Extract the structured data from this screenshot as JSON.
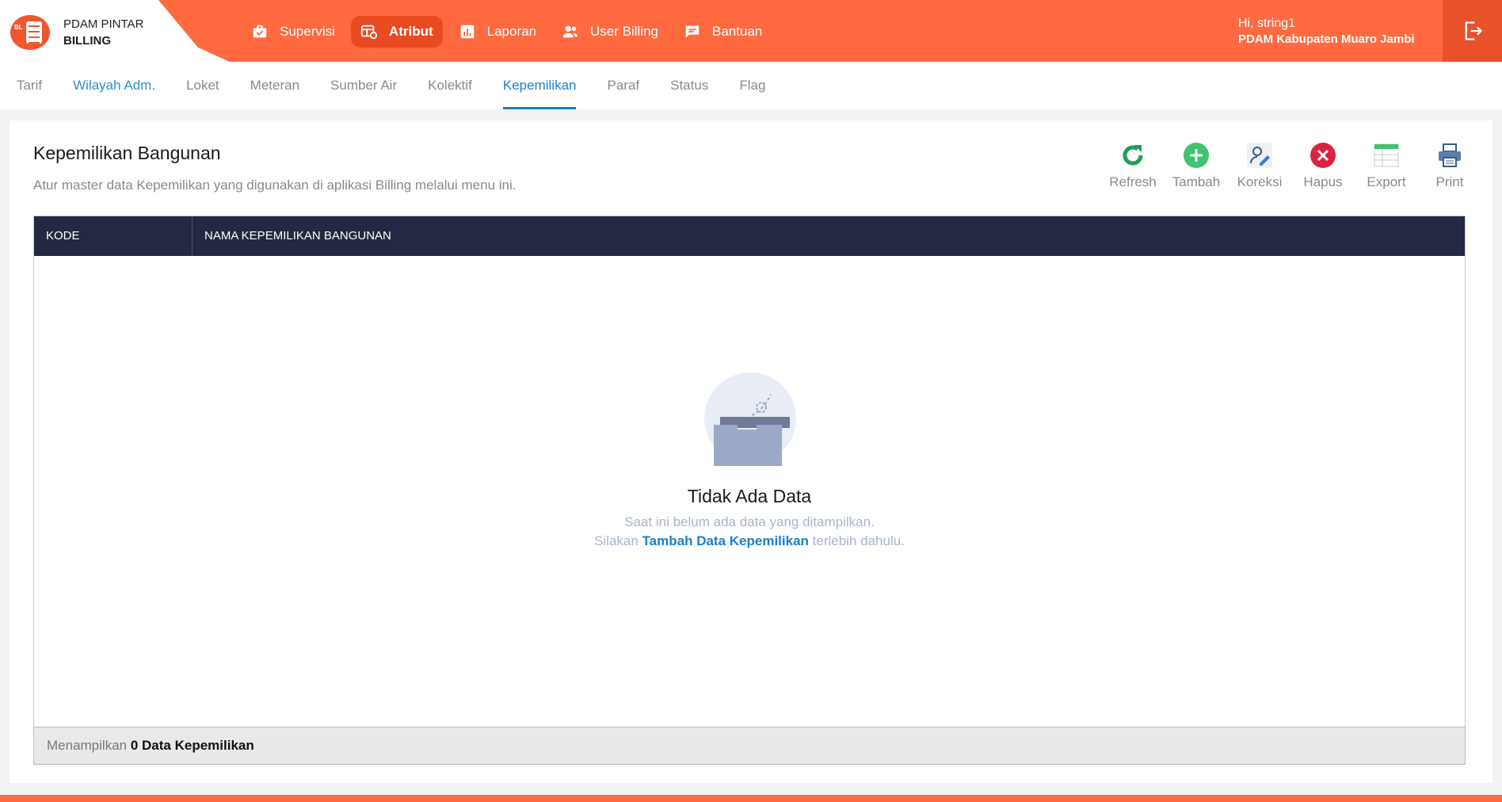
{
  "brand": {
    "line1": "PDAM PINTAR",
    "line2": "BILLING",
    "logo_text": "BL"
  },
  "mainnav": [
    {
      "label": "Supervisi",
      "icon": "briefcase-icon",
      "active": false
    },
    {
      "label": "Atribut",
      "icon": "table-settings-icon",
      "active": true
    },
    {
      "label": "Laporan",
      "icon": "bar-chart-icon",
      "active": false
    },
    {
      "label": "User Billing",
      "icon": "users-icon",
      "active": false
    },
    {
      "label": "Bantuan",
      "icon": "chat-icon",
      "active": false
    }
  ],
  "user": {
    "greeting": "Hi, string1",
    "org": "PDAM Kabupaten Muaro Jambi"
  },
  "subnav": [
    {
      "label": "Tarif"
    },
    {
      "label": "Wilayah Adm."
    },
    {
      "label": "Loket"
    },
    {
      "label": "Meteran"
    },
    {
      "label": "Sumber Air"
    },
    {
      "label": "Kolektif"
    },
    {
      "label": "Kepemilikan"
    },
    {
      "label": "Paraf"
    },
    {
      "label": "Status"
    },
    {
      "label": "Flag"
    }
  ],
  "page": {
    "title": "Kepemilikan Bangunan",
    "description": "Atur master data Kepemilikan yang digunakan di aplikasi Billing melalui menu ini."
  },
  "toolbar": {
    "refresh": "Refresh",
    "tambah": "Tambah",
    "koreksi": "Koreksi",
    "hapus": "Hapus",
    "export": "Export",
    "print": "Print"
  },
  "table": {
    "columns": [
      "KODE",
      "NAMA KEPEMILIKAN BANGUNAN"
    ],
    "rows": []
  },
  "empty": {
    "title": "Tidak Ada Data",
    "subtitle": "Saat ini belum ada data yang ditampilkan.",
    "cta_prefix": "Silakan",
    "cta_link": "Tambah Data Kepemilikan",
    "cta_suffix": "terlebih dahulu."
  },
  "footer": {
    "prefix": "Menampilkan",
    "count_text": "0 Data Kepemilikan"
  },
  "colors": {
    "brand": "#ff6a40",
    "header_dark": "#232943",
    "link": "#1a7fd0"
  }
}
